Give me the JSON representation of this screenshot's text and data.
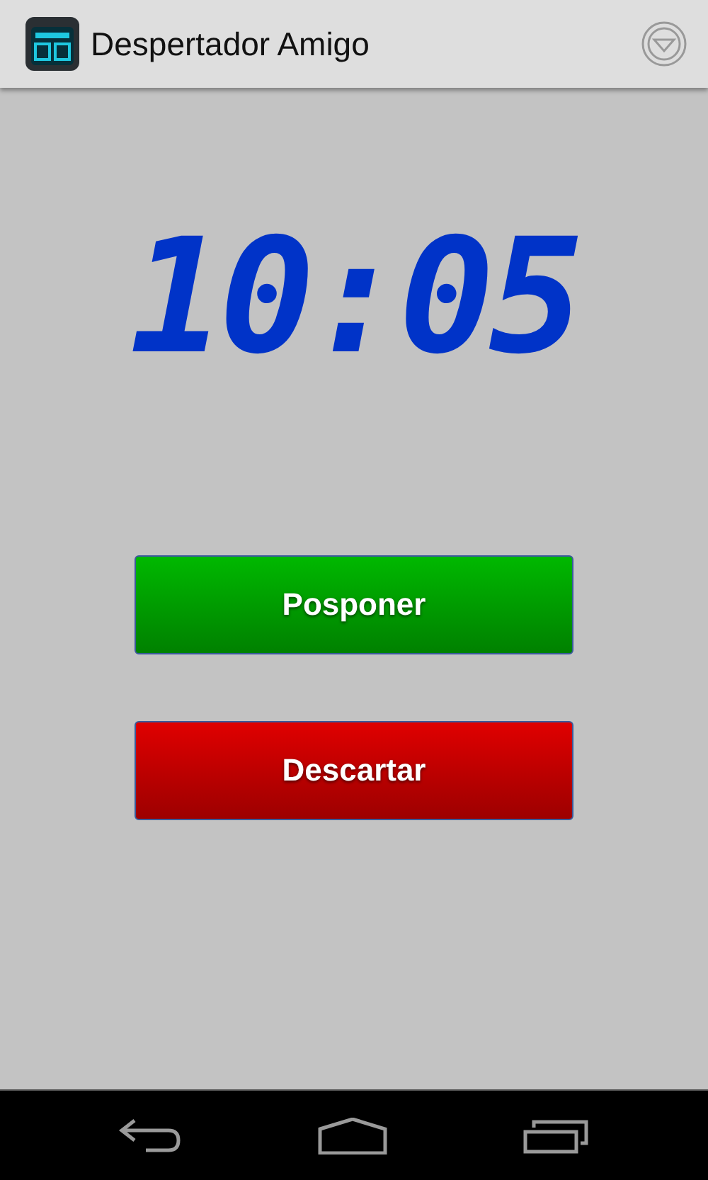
{
  "action_bar": {
    "title": "Despertador Amigo"
  },
  "clock": {
    "time": "10:05"
  },
  "buttons": [
    {
      "label": "Posponer",
      "color": "#00b800"
    },
    {
      "label": "Descartar",
      "color": "#e00000"
    }
  ]
}
